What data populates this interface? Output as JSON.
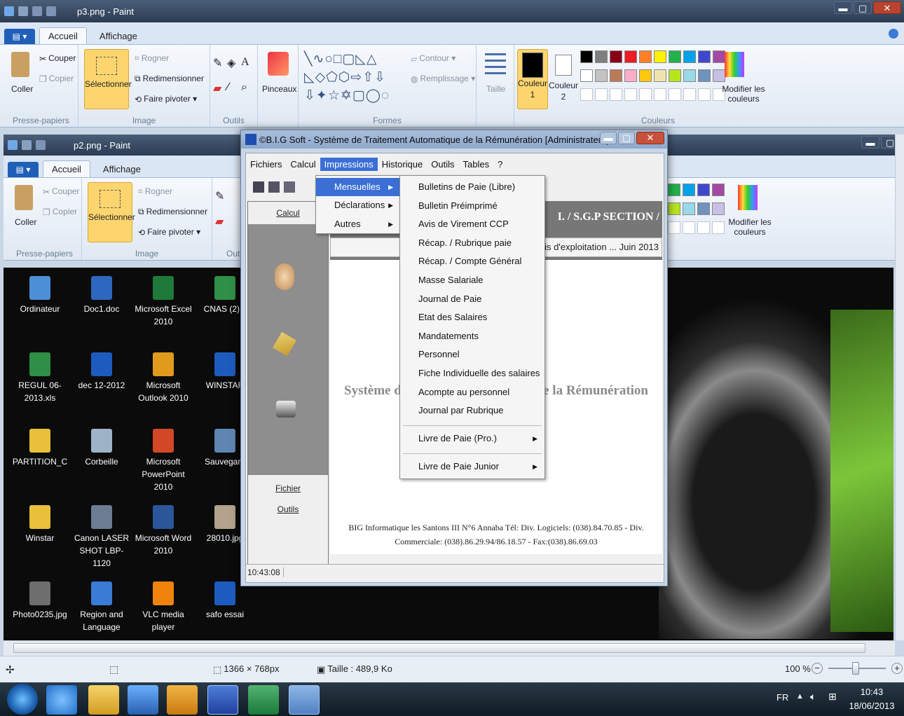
{
  "paint_back": {
    "title": "p3.png - Paint",
    "tabs": [
      "Accueil",
      "Affichage"
    ],
    "file_button": "▤ ▾",
    "groups": {
      "clipboard": "Presse-papiers",
      "image": "Image",
      "tools": "Outils",
      "shapes": "Formes",
      "colors": "Couleurs"
    },
    "buttons": {
      "paste": "Coller",
      "cut": "Couper",
      "copy": "Copier",
      "select": "Sélectionner",
      "crop": "Rogner",
      "resize": "Redimensionner",
      "rotate": "Faire pivoter",
      "brushes": "Pinceaux",
      "outline": "Contour",
      "fill": "Remplissage",
      "size": "Taille",
      "color1": "Couleur\n1",
      "color2": "Couleur\n2",
      "edit_colors": "Modifier les couleurs"
    },
    "palette": [
      "#000000",
      "#7f7f7f",
      "#880015",
      "#ed1c24",
      "#ff7f27",
      "#fff200",
      "#22b14c",
      "#00a2e8",
      "#3f48cc",
      "#a349a4",
      "#ffffff",
      "#c3c3c3",
      "#b97a57",
      "#ffaec9",
      "#ffc90e",
      "#efe4b0",
      "#b5e61d",
      "#99d9ea",
      "#7092be",
      "#c8bfe7"
    ]
  },
  "paint_front": {
    "title": "p2.png - Paint",
    "tabs": [
      "Accueil",
      "Affichage"
    ],
    "groups": {
      "clipboard": "Presse-papiers",
      "image": "Image",
      "tools": "Out"
    },
    "buttons": {
      "paste": "Coller",
      "cut": "Couper",
      "copy": "Copier",
      "select": "Sélectionner",
      "crop": "Rogner",
      "resize": "Redimensionner",
      "rotate": "Faire pivoter",
      "edit_colors": "Modifier les couleurs"
    }
  },
  "desktop_icons": [
    {
      "label": "Ordinateur",
      "color": "#4d8fd6"
    },
    {
      "label": "Doc1.doc",
      "color": "#2e67c0"
    },
    {
      "label": "Microsoft Excel 2010",
      "color": "#1f7a3a"
    },
    {
      "label": "CNAS (2).x",
      "color": "#2f8f46"
    },
    {
      "label": "REGUL 06-2013.xls",
      "color": "#2f8f46"
    },
    {
      "label": "dec 12-2012",
      "color": "#1e5bbf"
    },
    {
      "label": "Microsoft Outlook 2010",
      "color": "#e09a1c"
    },
    {
      "label": "WINSTAR",
      "color": "#1e5bbf"
    },
    {
      "label": "PARTITION_C",
      "color": "#e9c03a"
    },
    {
      "label": "Corbeille",
      "color": "#9fb3c8"
    },
    {
      "label": "Microsoft PowerPoint 2010",
      "color": "#d24726"
    },
    {
      "label": "Sauvegard",
      "color": "#5f86b3"
    },
    {
      "label": "Winstar",
      "color": "#e9c03a"
    },
    {
      "label": "Canon LASER SHOT LBP-1120",
      "color": "#6b7d92"
    },
    {
      "label": "Microsoft Word 2010",
      "color": "#2b579a"
    },
    {
      "label": "28010.jpg",
      "color": "#b3a28c"
    },
    {
      "label": "Photo0235.jpg",
      "color": "#6e6e6e"
    },
    {
      "label": "Region and Language",
      "color": "#3a7bd5"
    },
    {
      "label": "VLC media player",
      "color": "#f0830c"
    },
    {
      "label": "safo essai",
      "color": "#1e5bbf"
    }
  ],
  "app": {
    "title": "©B.I.G Soft - Système de Traitement Automatique de la Rémunération  [Administrateur]",
    "menubar": [
      "Fichiers",
      "Calcul",
      "Impressions",
      "Historique",
      "Outils",
      "Tables",
      "?"
    ],
    "active_menu": "Impressions",
    "left_panel": {
      "calcul": "Calcul",
      "fichier": "Fichier",
      "outils": "Outils"
    },
    "header_section": "I. / S.G.P  SECTION /",
    "period": "Mois d'exploitation ... Juin 2013",
    "watermark_left": "Système d",
    "watermark_right": "le la Rémunération",
    "footer_line1": "BIG Informatique les Santons III N°6 Annaba Tél: Div. Logiciels: (038).84.70.85 - Div.",
    "footer_line2": "Commerciale: (038).86.29.94/86.18.57 - Fax:(038).86.69.03",
    "clock": "10:43:08"
  },
  "impressions_menu": {
    "items": [
      "Mensuelles",
      "Déclarations",
      "Autres"
    ],
    "selected": "Mensuelles"
  },
  "mensuelles_menu": {
    "items": [
      "Bulletins de Paie (Libre)",
      "Bulletin Préimprimé",
      "Avis de Virement CCP",
      "Récap. / Rubrique paie",
      "Récap.  / Compte Général",
      "Masse Salariale",
      "Journal de Paie",
      "Etat des Salaires",
      "Mandatements",
      "Personnel",
      "Fiche Individuelle des salaires",
      "Acompte au personnel",
      "Journal par Rubrique"
    ],
    "submenus": [
      "Livre de Paie (Pro.)",
      "Livre de Paie Junior"
    ]
  },
  "paint_status": {
    "dimensions": "1366 × 768px",
    "size": "Taille : 489,9 Ko",
    "zoom": "100 %"
  },
  "taskbar": {
    "lang": "FR",
    "time": "10:43",
    "date": "18/06/2013"
  }
}
